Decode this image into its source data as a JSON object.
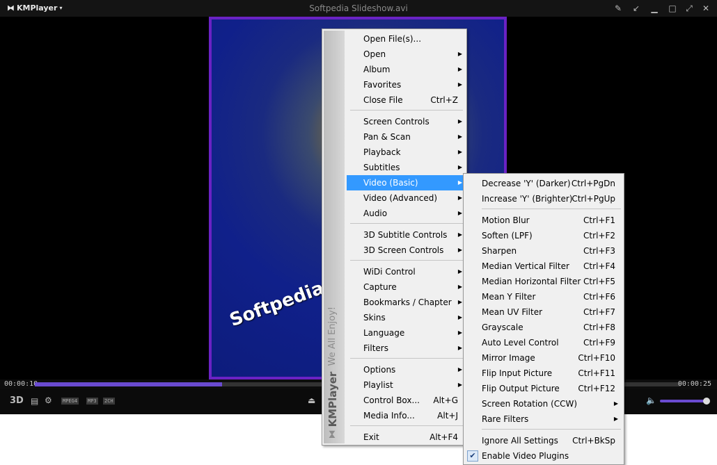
{
  "window": {
    "app_name": "KMPlayer",
    "title": "Softpedia Slideshow.avi"
  },
  "video": {
    "overlay_text": "Softpedia test"
  },
  "playback": {
    "elapsed": "00:00:10",
    "remaining": "00:00:25",
    "progress_fraction": 0.29
  },
  "controls": {
    "badges": [
      "MPEG4",
      "MP3",
      "2CH"
    ],
    "volume_fraction": 0.92
  },
  "main_menu": {
    "brand": "KMPlayer",
    "tagline": "We All Enjoy!",
    "items": [
      {
        "label": "Open File(s)...",
        "shortcut": ""
      },
      {
        "label": "Open",
        "shortcut": ""
      },
      {
        "label": "Album",
        "shortcut": ""
      },
      {
        "label": "Favorites",
        "shortcut": ""
      },
      {
        "label": "Close File",
        "shortcut": "Ctrl+Z"
      },
      {
        "label": "Screen Controls",
        "shortcut": ""
      },
      {
        "label": "Pan & Scan",
        "shortcut": ""
      },
      {
        "label": "Playback",
        "shortcut": ""
      },
      {
        "label": "Subtitles",
        "shortcut": ""
      },
      {
        "label": "Video (Basic)",
        "shortcut": ""
      },
      {
        "label": "Video (Advanced)",
        "shortcut": ""
      },
      {
        "label": "Audio",
        "shortcut": ""
      },
      {
        "label": "3D Subtitle Controls",
        "shortcut": ""
      },
      {
        "label": "3D Screen Controls",
        "shortcut": ""
      },
      {
        "label": "WiDi Control",
        "shortcut": ""
      },
      {
        "label": "Capture",
        "shortcut": ""
      },
      {
        "label": "Bookmarks / Chapter",
        "shortcut": ""
      },
      {
        "label": "Skins",
        "shortcut": ""
      },
      {
        "label": "Language",
        "shortcut": ""
      },
      {
        "label": "Filters",
        "shortcut": ""
      },
      {
        "label": "Options",
        "shortcut": ""
      },
      {
        "label": "Playlist",
        "shortcut": ""
      },
      {
        "label": "Control Box...",
        "shortcut": "Alt+G"
      },
      {
        "label": "Media Info...",
        "shortcut": "Alt+J"
      },
      {
        "label": "Exit",
        "shortcut": "Alt+F4"
      }
    ]
  },
  "video_basic_menu": {
    "items": [
      {
        "label": "Decrease 'Y' (Darker)",
        "shortcut": "Ctrl+PgDn"
      },
      {
        "label": "Increase 'Y' (Brighter)",
        "shortcut": "Ctrl+PgUp"
      },
      {
        "label": "Motion Blur",
        "shortcut": "Ctrl+F1"
      },
      {
        "label": "Soften (LPF)",
        "shortcut": "Ctrl+F2"
      },
      {
        "label": "Sharpen",
        "shortcut": "Ctrl+F3"
      },
      {
        "label": "Median Vertical Filter",
        "shortcut": "Ctrl+F4"
      },
      {
        "label": "Median Horizontal Filter",
        "shortcut": "Ctrl+F5"
      },
      {
        "label": "Mean Y Filter",
        "shortcut": "Ctrl+F6"
      },
      {
        "label": "Mean UV Filter",
        "shortcut": "Ctrl+F7"
      },
      {
        "label": "Grayscale",
        "shortcut": "Ctrl+F8"
      },
      {
        "label": "Auto Level Control",
        "shortcut": "Ctrl+F9"
      },
      {
        "label": "Mirror Image",
        "shortcut": "Ctrl+F10"
      },
      {
        "label": "Flip Input Picture",
        "shortcut": "Ctrl+F11"
      },
      {
        "label": "Flip Output Picture",
        "shortcut": "Ctrl+F12"
      },
      {
        "label": "Screen Rotation (CCW)",
        "shortcut": ""
      },
      {
        "label": "Rare Filters",
        "shortcut": ""
      },
      {
        "label": "Ignore All Settings",
        "shortcut": "Ctrl+BkSp"
      },
      {
        "label": "Enable Video Plugins",
        "shortcut": "",
        "checked": true
      }
    ]
  },
  "colors": {
    "accent": "#6a4bd0",
    "highlight": "#3399ff",
    "video_border": "#6a22c4"
  }
}
